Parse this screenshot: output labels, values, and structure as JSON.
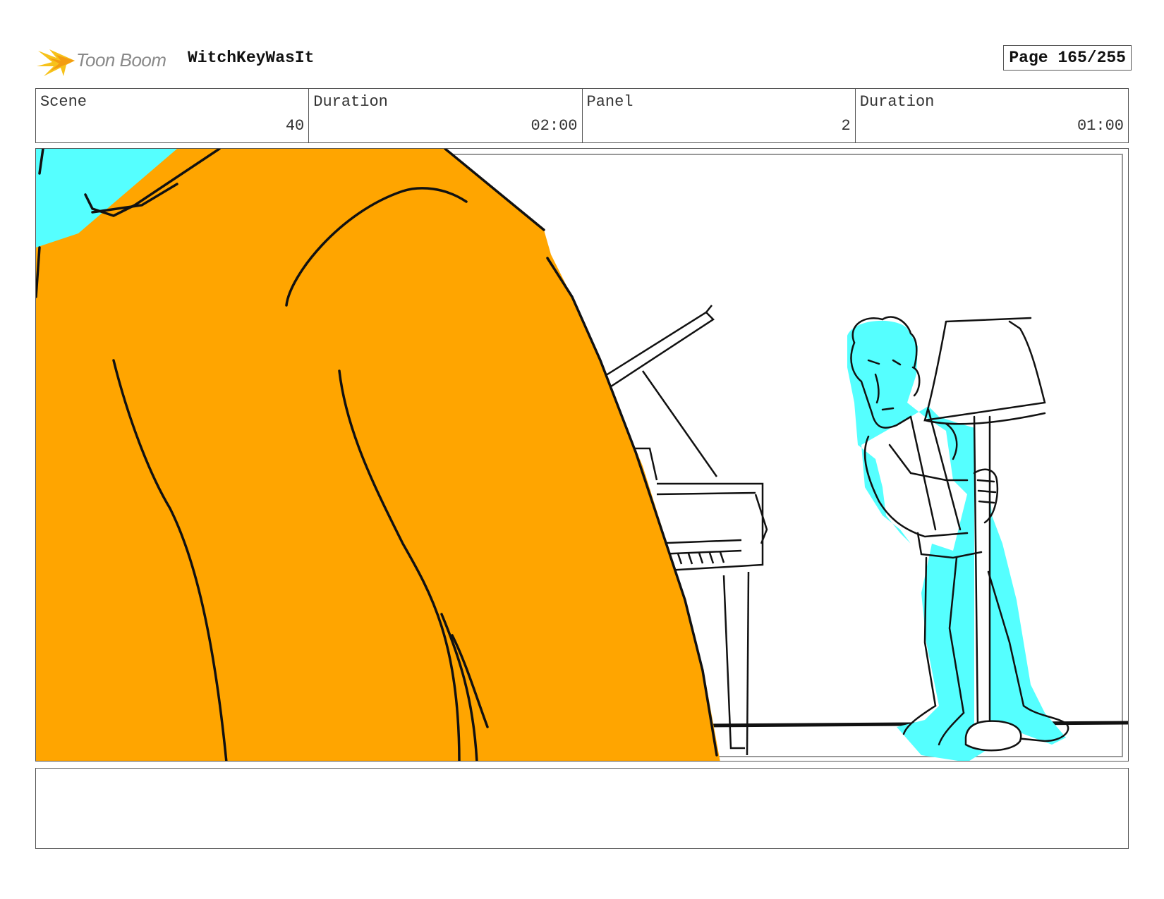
{
  "header": {
    "logo_text": "Toon Boom",
    "project_title": "WitchKeyWasIt",
    "page_label": "Page 165/255"
  },
  "info": {
    "scene_label": "Scene",
    "scene_value": "40",
    "scene_duration_label": "Duration",
    "scene_duration_value": "02:00",
    "panel_label": "Panel",
    "panel_value": "2",
    "panel_duration_label": "Duration",
    "panel_duration_value": "01:00"
  },
  "colors": {
    "foreground_figure": "#ffa500",
    "character_fill": "#55ffff",
    "line": "#111111",
    "logo_accent": "#f7c21a"
  },
  "notes": {
    "text": ""
  }
}
